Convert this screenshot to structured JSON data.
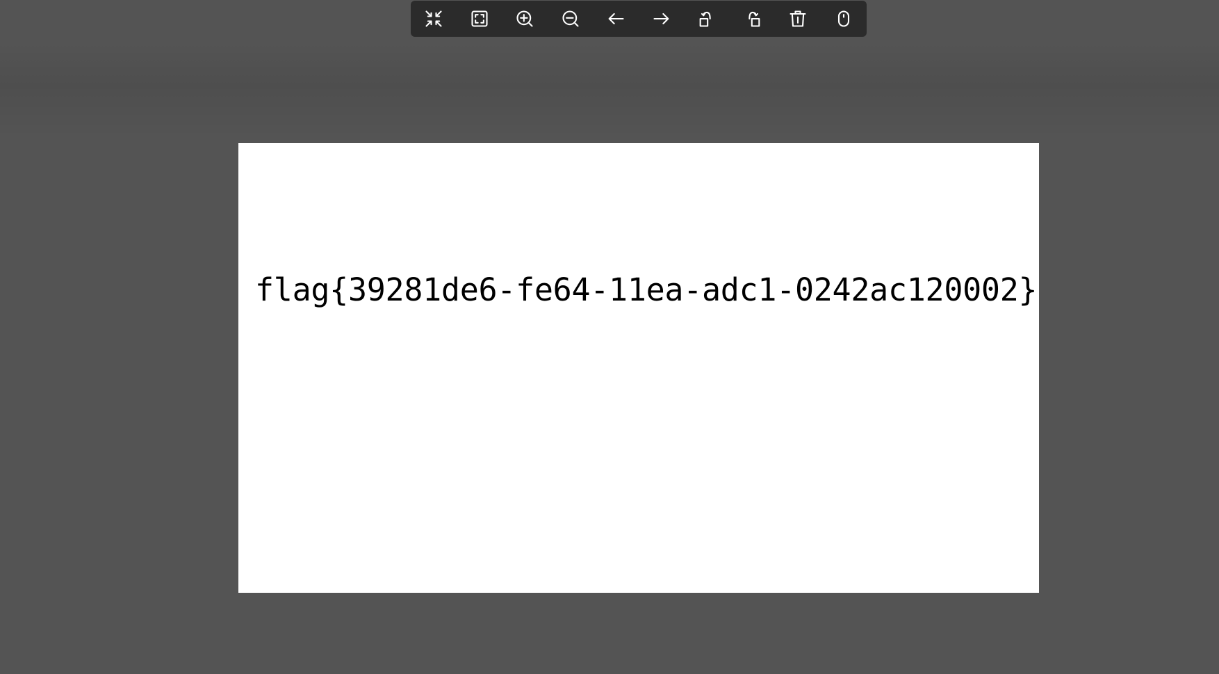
{
  "viewer": {
    "background_color": "#545454",
    "toolbar_color": "#2b2b2b",
    "icon_color": "#ffffff"
  },
  "toolbar": {
    "buttons": [
      {
        "icon": "collapse-icon"
      },
      {
        "icon": "fit-screen-icon"
      },
      {
        "icon": "zoom-in-icon"
      },
      {
        "icon": "zoom-out-icon"
      },
      {
        "icon": "arrow-left-icon"
      },
      {
        "icon": "arrow-right-icon"
      },
      {
        "icon": "rotate-left-icon"
      },
      {
        "icon": "rotate-right-icon"
      },
      {
        "icon": "trash-icon"
      },
      {
        "icon": "mouse-icon"
      }
    ]
  },
  "image": {
    "text": "flag{39281de6-fe64-11ea-adc1-0242ac120002}"
  }
}
